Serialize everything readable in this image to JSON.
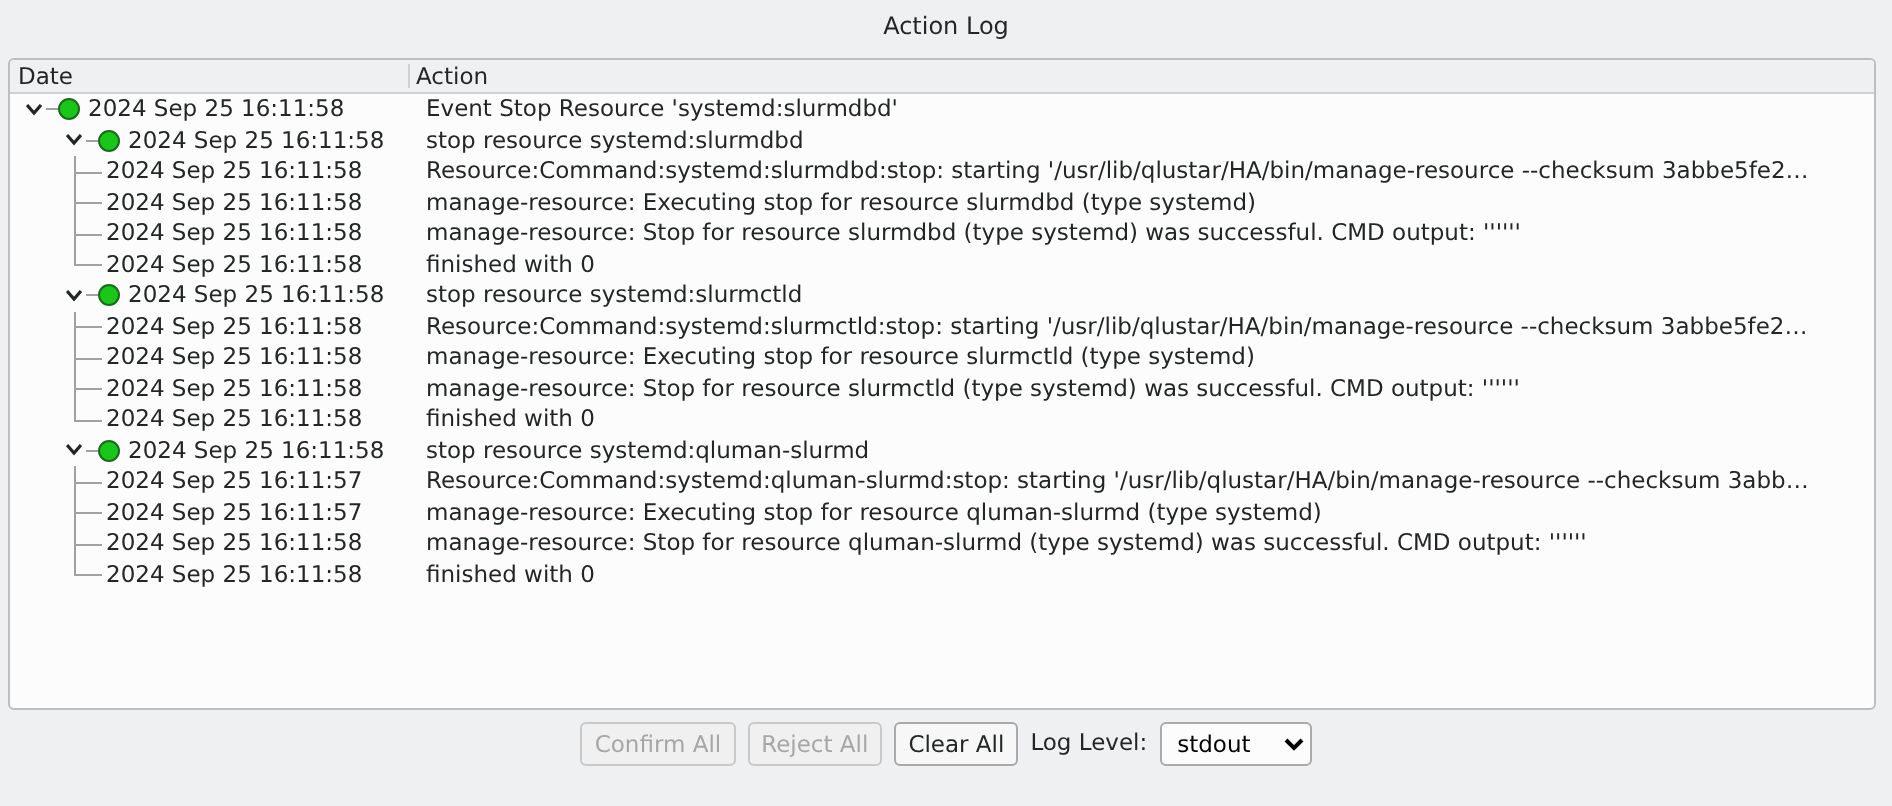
{
  "window": {
    "title": "Action Log"
  },
  "table": {
    "columns": [
      "Date",
      "Action"
    ],
    "rows": [
      {
        "date": "2024 Sep 25 16:11:58",
        "action": "Event Stop Resource 'systemd:slurmdbd'",
        "expanded": true,
        "children": [
          {
            "date": "2024 Sep 25 16:11:58",
            "action": "stop resource systemd:slurmdbd",
            "expanded": true,
            "children": [
              {
                "date": "2024 Sep 25 16:11:58",
                "action": "Resource:Command:systemd:slurmdbd:stop: starting '/usr/lib/qlustar/HA/bin/manage-resource --checksum 3abbe5fe2…"
              },
              {
                "date": "2024 Sep 25 16:11:58",
                "action": "manage-resource: Executing stop for resource slurmdbd (type systemd)"
              },
              {
                "date": "2024 Sep 25 16:11:58",
                "action": "manage-resource: Stop for resource slurmdbd (type systemd) was successful. CMD output: ''''''"
              },
              {
                "date": "2024 Sep 25 16:11:58",
                "action": "finished with 0"
              }
            ]
          },
          {
            "date": "2024 Sep 25 16:11:58",
            "action": "stop resource systemd:slurmctld",
            "expanded": true,
            "children": [
              {
                "date": "2024 Sep 25 16:11:58",
                "action": "Resource:Command:systemd:slurmctld:stop: starting '/usr/lib/qlustar/HA/bin/manage-resource --checksum 3abbe5fe2…"
              },
              {
                "date": "2024 Sep 25 16:11:58",
                "action": "manage-resource: Executing stop for resource slurmctld (type systemd)"
              },
              {
                "date": "2024 Sep 25 16:11:58",
                "action": "manage-resource: Stop for resource slurmctld (type systemd) was successful. CMD output: ''''''"
              },
              {
                "date": "2024 Sep 25 16:11:58",
                "action": "finished with 0"
              }
            ]
          },
          {
            "date": "2024 Sep 25 16:11:58",
            "action": "stop resource systemd:qluman-slurmd",
            "expanded": true,
            "children": [
              {
                "date": "2024 Sep 25 16:11:57",
                "action": "Resource:Command:systemd:qluman-slurmd:stop: starting '/usr/lib/qlustar/HA/bin/manage-resource --checksum 3abb…"
              },
              {
                "date": "2024 Sep 25 16:11:57",
                "action": "manage-resource: Executing stop for resource qluman-slurmd (type systemd)"
              },
              {
                "date": "2024 Sep 25 16:11:58",
                "action": "manage-resource: Stop for resource qluman-slurmd (type systemd) was successful. CMD output: ''''''"
              },
              {
                "date": "2024 Sep 25 16:11:58",
                "action": "finished with 0"
              }
            ]
          }
        ]
      }
    ]
  },
  "buttons": [
    {
      "label": "Confirm All",
      "disabled": true
    },
    {
      "label": "Reject All",
      "disabled": true
    },
    {
      "label": "Clear All",
      "disabled": false
    }
  ],
  "log_level": {
    "label": "Log Level:",
    "value": "stdout"
  }
}
